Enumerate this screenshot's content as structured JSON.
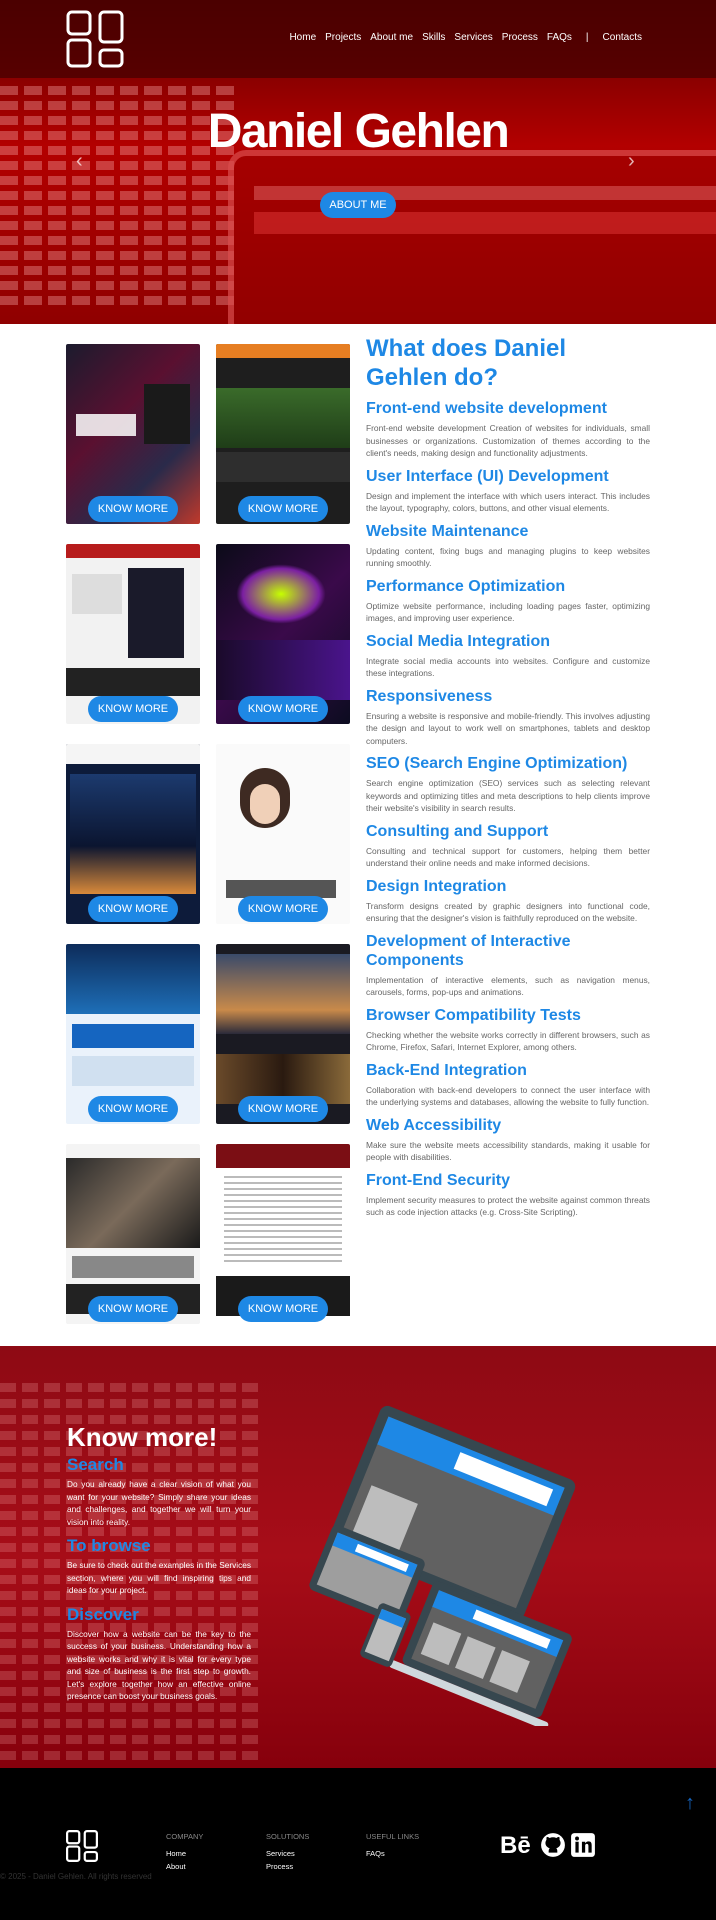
{
  "site": {
    "owner": "Daniel Gehlen"
  },
  "nav": {
    "items": [
      "Home",
      "Projects",
      "About me",
      "Skills",
      "Services",
      "Process",
      "FAQs"
    ],
    "separator": "|",
    "contacts": "Contacts"
  },
  "hero": {
    "title": "Daniel Gehlen",
    "about_button": "ABOUT ME",
    "prev_arrow": "‹",
    "next_arrow": "›"
  },
  "projects": {
    "button_label": "KNOW MORE",
    "count": 10
  },
  "services": {
    "heading": "What does Daniel Gehlen do?",
    "items": [
      {
        "title": "Front-end website development",
        "text": "Front-end website development Creation of websites for individuals, small businesses or organizations. Customization of themes according to the client's needs, making design and functionality adjustments."
      },
      {
        "title": "User Interface (UI) Development",
        "text": "Design and implement the interface with which users interact. This includes the layout, typography, colors, buttons, and other visual elements."
      },
      {
        "title": "Website Maintenance",
        "text": "Updating content, fixing bugs and managing plugins to keep websites running smoothly."
      },
      {
        "title": "Performance Optimization",
        "text": "Optimize website performance, including loading pages faster, optimizing images, and improving user experience."
      },
      {
        "title": "Social Media Integration",
        "text": "Integrate social media accounts into websites. Configure and customize these integrations."
      },
      {
        "title": "Responsiveness",
        "text": "Ensuring a website is responsive and mobile-friendly. This involves adjusting the design and layout to work well on smartphones, tablets and desktop computers."
      },
      {
        "title": "SEO (Search Engine Optimization)",
        "text": "Search engine optimization (SEO) services such as selecting relevant keywords and optimizing titles and meta descriptions to help clients improve their website's visibility in search results."
      },
      {
        "title": "Consulting and Support",
        "text": "Consulting and technical support for customers, helping them better understand their online needs and make informed decisions."
      },
      {
        "title": "Design Integration",
        "text": "Transform designs created by graphic designers into functional code, ensuring that the designer's vision is faithfully reproduced on the website."
      },
      {
        "title": "Development of Interactive Components",
        "text": "Implementation of interactive elements, such as navigation menus, carousels, forms, pop-ups and animations."
      },
      {
        "title": "Browser Compatibility Tests",
        "text": "Checking whether the website works correctly in different browsers, such as Chrome, Firefox, Safari, Internet Explorer, among others."
      },
      {
        "title": "Back-End Integration",
        "text": "Collaboration with back-end developers to connect the user interface with the underlying systems and databases, allowing the website to fully function."
      },
      {
        "title": "Web Accessibility",
        "text": "Make sure the website meets accessibility standards, making it usable for people with disabilities."
      },
      {
        "title": "Front-End Security",
        "text": "Implement security measures to protect the website against common threats such as code injection attacks (e.g. Cross-Site Scripting)."
      }
    ]
  },
  "know_more": {
    "heading": "Know more!",
    "blocks": [
      {
        "title": "Search",
        "text": "Do you already have a clear vision of what you want for your website? Simply share your ideas and challenges, and together we will turn your vision into reality."
      },
      {
        "title": "To browse",
        "text": "Be sure to check out the examples in the Services section, where you will find inspiring tips and ideas for your project."
      },
      {
        "title": "Discover",
        "text": "Discover how a website can be the key to the success of your business. Understanding how a website works and why it is vital for every type and size of business is the first step to growth. Let's explore together how an effective online presence can boost your business goals."
      }
    ]
  },
  "footer": {
    "columns": [
      {
        "title": "COMPANY",
        "links": [
          "Home",
          "About"
        ]
      },
      {
        "title": "SOLUTIONS",
        "links": [
          "Services",
          "Process"
        ]
      },
      {
        "title": "USEFUL LINKS",
        "links": [
          "FAQs"
        ]
      }
    ],
    "social": {
      "behance": "Bē"
    },
    "copyright": "© 2025 - Daniel Gehlen. All rights reserved",
    "back_to_top": "↑"
  },
  "colors": {
    "accent": "#1e88e5",
    "hero_red": "#b30000",
    "footer_bg": "#000000",
    "text_gray": "#666666"
  },
  "icons": [
    "logo-icon",
    "chevron-left-icon",
    "chevron-right-icon",
    "behance-icon",
    "github-icon",
    "linkedin-icon",
    "arrow-up-icon"
  ]
}
